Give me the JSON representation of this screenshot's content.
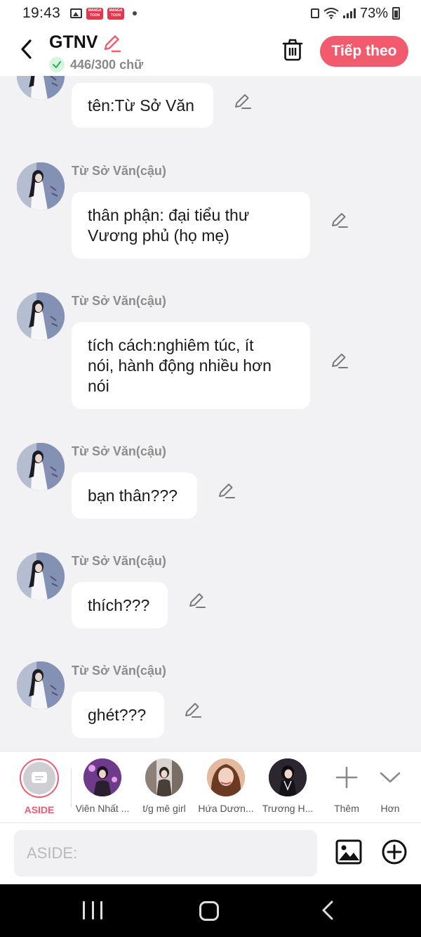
{
  "status_bar": {
    "time": "19:43",
    "battery": "73%",
    "manga_badge": "MANGA TOON"
  },
  "header": {
    "title": "GTNV",
    "word_count": "446/300 chữ",
    "next_label": "Tiếp theo"
  },
  "messages": [
    {
      "sender": "",
      "text": "tên:Từ Sở Văn"
    },
    {
      "sender": "Từ Sở Văn(cậu)",
      "text": "thân phận: đại tiểu thư\nVương phủ (họ mẹ)"
    },
    {
      "sender": "Từ Sở Văn(cậu)",
      "text": "tích cách:nghiêm túc, ít\nnói, hành động nhiều hơn\nnói"
    },
    {
      "sender": "Từ Sở Văn(cậu)",
      "text": "bạn thân???"
    },
    {
      "sender": "Từ Sở Văn(cậu)",
      "text": "thích???"
    },
    {
      "sender": "Từ Sở Văn(cậu)",
      "text": "ghét???"
    }
  ],
  "characters": [
    {
      "label": "ASIDE",
      "color": "#cfcfd3"
    },
    {
      "label": "Viên Nhất ...",
      "color": "#9b4fb0"
    },
    {
      "label": "t/g mê girl",
      "color": "#a79d95"
    },
    {
      "label": "Hứa Dươn...",
      "color": "#b6673f"
    },
    {
      "label": "Trương H...",
      "color": "#2b2630"
    }
  ],
  "char_actions": {
    "more_label": "Thêm",
    "expand_label": "Hơn"
  },
  "input": {
    "placeholder": "ASIDE:"
  },
  "colors": {
    "accent": "#f25a6e",
    "background": "#f2f2f4",
    "bubble": "#ffffff"
  }
}
